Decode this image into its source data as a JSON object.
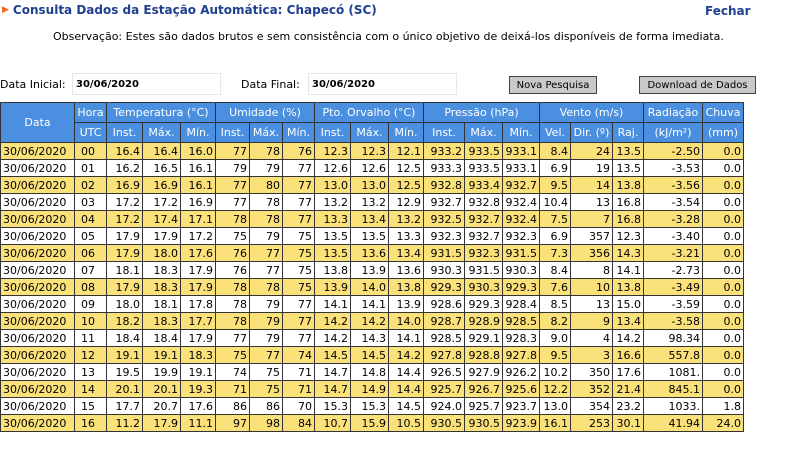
{
  "header": {
    "title": "Consulta Dados da Estação Automática: Chapecó (SC)",
    "close_label": "Fechar",
    "observation": "Observação: Estes são dados brutos e sem consistência com o único objetivo de deixá-los disponíveis de forma imediata."
  },
  "filters": {
    "start_label": "Data Inicial:",
    "start_value": "30/06/2020",
    "end_label": "Data Final:",
    "end_value": "30/06/2020",
    "new_search_label": "Nova Pesquisa",
    "download_label": "Download de Dados"
  },
  "table": {
    "groups": [
      "Data",
      "Hora",
      "Temperatura (°C)",
      "Umidade (%)",
      "Pto. Orvalho (°C)",
      "Pressão (hPa)",
      "Vento (m/s)",
      "Radiação",
      "Chuva"
    ],
    "subheaders": [
      "UTC",
      "Inst.",
      "Máx.",
      "Mín.",
      "Inst.",
      "Máx.",
      "Mín.",
      "Inst.",
      "Máx.",
      "Mín.",
      "Inst.",
      "Máx.",
      "Mín.",
      "Vel.",
      "Dir. (º)",
      "Raj.",
      "(kJ/m²)",
      "(mm)"
    ],
    "rows": [
      [
        "30/06/2020",
        "00",
        "16.4",
        "16.4",
        "16.0",
        "77",
        "78",
        "76",
        "12.3",
        "12.3",
        "12.1",
        "933.2",
        "933.5",
        "933.1",
        "8.4",
        "24",
        "13.5",
        "-2.50",
        "0.0"
      ],
      [
        "30/06/2020",
        "01",
        "16.2",
        "16.5",
        "16.1",
        "79",
        "79",
        "77",
        "12.6",
        "12.6",
        "12.5",
        "933.3",
        "933.5",
        "933.1",
        "6.9",
        "19",
        "13.5",
        "-3.53",
        "0.0"
      ],
      [
        "30/06/2020",
        "02",
        "16.9",
        "16.9",
        "16.1",
        "77",
        "80",
        "77",
        "13.0",
        "13.0",
        "12.5",
        "932.8",
        "933.4",
        "932.7",
        "9.5",
        "14",
        "13.8",
        "-3.56",
        "0.0"
      ],
      [
        "30/06/2020",
        "03",
        "17.2",
        "17.2",
        "16.9",
        "77",
        "78",
        "77",
        "13.2",
        "13.2",
        "12.9",
        "932.7",
        "932.8",
        "932.4",
        "10.4",
        "13",
        "16.8",
        "-3.54",
        "0.0"
      ],
      [
        "30/06/2020",
        "04",
        "17.2",
        "17.4",
        "17.1",
        "78",
        "78",
        "77",
        "13.3",
        "13.4",
        "13.2",
        "932.5",
        "932.7",
        "932.4",
        "7.5",
        "7",
        "16.8",
        "-3.28",
        "0.0"
      ],
      [
        "30/06/2020",
        "05",
        "17.9",
        "17.9",
        "17.2",
        "75",
        "79",
        "75",
        "13.5",
        "13.5",
        "13.3",
        "932.3",
        "932.7",
        "932.3",
        "6.9",
        "357",
        "12.3",
        "-3.40",
        "0.0"
      ],
      [
        "30/06/2020",
        "06",
        "17.9",
        "18.0",
        "17.6",
        "76",
        "77",
        "75",
        "13.5",
        "13.6",
        "13.4",
        "931.5",
        "932.3",
        "931.5",
        "7.3",
        "356",
        "14.3",
        "-3.21",
        "0.0"
      ],
      [
        "30/06/2020",
        "07",
        "18.1",
        "18.3",
        "17.9",
        "76",
        "77",
        "75",
        "13.8",
        "13.9",
        "13.6",
        "930.3",
        "931.5",
        "930.3",
        "8.4",
        "8",
        "14.1",
        "-2.73",
        "0.0"
      ],
      [
        "30/06/2020",
        "08",
        "17.9",
        "18.3",
        "17.9",
        "78",
        "78",
        "75",
        "13.9",
        "14.0",
        "13.8",
        "929.3",
        "930.3",
        "929.3",
        "7.6",
        "10",
        "13.8",
        "-3.49",
        "0.0"
      ],
      [
        "30/06/2020",
        "09",
        "18.0",
        "18.1",
        "17.8",
        "78",
        "79",
        "77",
        "14.1",
        "14.1",
        "13.9",
        "928.6",
        "929.3",
        "928.4",
        "8.5",
        "13",
        "15.0",
        "-3.59",
        "0.0"
      ],
      [
        "30/06/2020",
        "10",
        "18.2",
        "18.3",
        "17.7",
        "78",
        "79",
        "77",
        "14.2",
        "14.2",
        "14.0",
        "928.7",
        "928.9",
        "928.5",
        "8.2",
        "9",
        "13.4",
        "-3.58",
        "0.0"
      ],
      [
        "30/06/2020",
        "11",
        "18.4",
        "18.4",
        "17.9",
        "77",
        "79",
        "77",
        "14.2",
        "14.3",
        "14.1",
        "928.5",
        "929.1",
        "928.3",
        "9.0",
        "4",
        "14.2",
        "98.34",
        "0.0"
      ],
      [
        "30/06/2020",
        "12",
        "19.1",
        "19.1",
        "18.3",
        "75",
        "77",
        "74",
        "14.5",
        "14.5",
        "14.2",
        "927.8",
        "928.8",
        "927.8",
        "9.5",
        "3",
        "16.6",
        "557.8",
        "0.0"
      ],
      [
        "30/06/2020",
        "13",
        "19.5",
        "19.9",
        "19.1",
        "74",
        "75",
        "71",
        "14.7",
        "14.8",
        "14.4",
        "926.5",
        "927.9",
        "926.2",
        "10.2",
        "350",
        "17.6",
        "1081.",
        "0.0"
      ],
      [
        "30/06/2020",
        "14",
        "20.1",
        "20.1",
        "19.3",
        "71",
        "75",
        "71",
        "14.7",
        "14.9",
        "14.4",
        "925.7",
        "926.7",
        "925.6",
        "12.2",
        "352",
        "21.4",
        "845.1",
        "0.0"
      ],
      [
        "30/06/2020",
        "15",
        "17.7",
        "20.7",
        "17.6",
        "86",
        "86",
        "70",
        "15.3",
        "15.3",
        "14.5",
        "924.0",
        "925.7",
        "923.7",
        "13.0",
        "354",
        "23.2",
        "1033.",
        "1.8"
      ],
      [
        "30/06/2020",
        "16",
        "11.2",
        "17.9",
        "11.1",
        "97",
        "98",
        "84",
        "10.7",
        "15.9",
        "10.5",
        "930.5",
        "930.5",
        "923.9",
        "16.1",
        "253",
        "30.1",
        "41.94",
        "24.0"
      ]
    ]
  }
}
